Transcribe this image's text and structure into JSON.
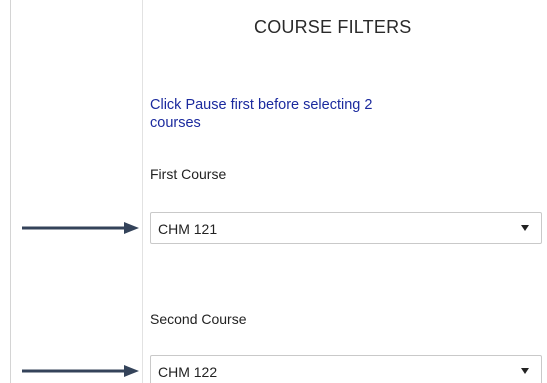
{
  "panel": {
    "title": "COURSE FILTERS",
    "notice": "Click Pause first before selecting 2 courses"
  },
  "first_course": {
    "label": "First Course",
    "selected": "CHM 121"
  },
  "second_course": {
    "label": "Second Course",
    "selected": "CHM 122"
  },
  "icons": {
    "dropdown": "caret-down-icon",
    "pointer": "arrow-right-icon"
  },
  "colors": {
    "notice_text": "#1b2a9e",
    "arrow": "#34435a",
    "select_border": "#c9c9c9"
  }
}
